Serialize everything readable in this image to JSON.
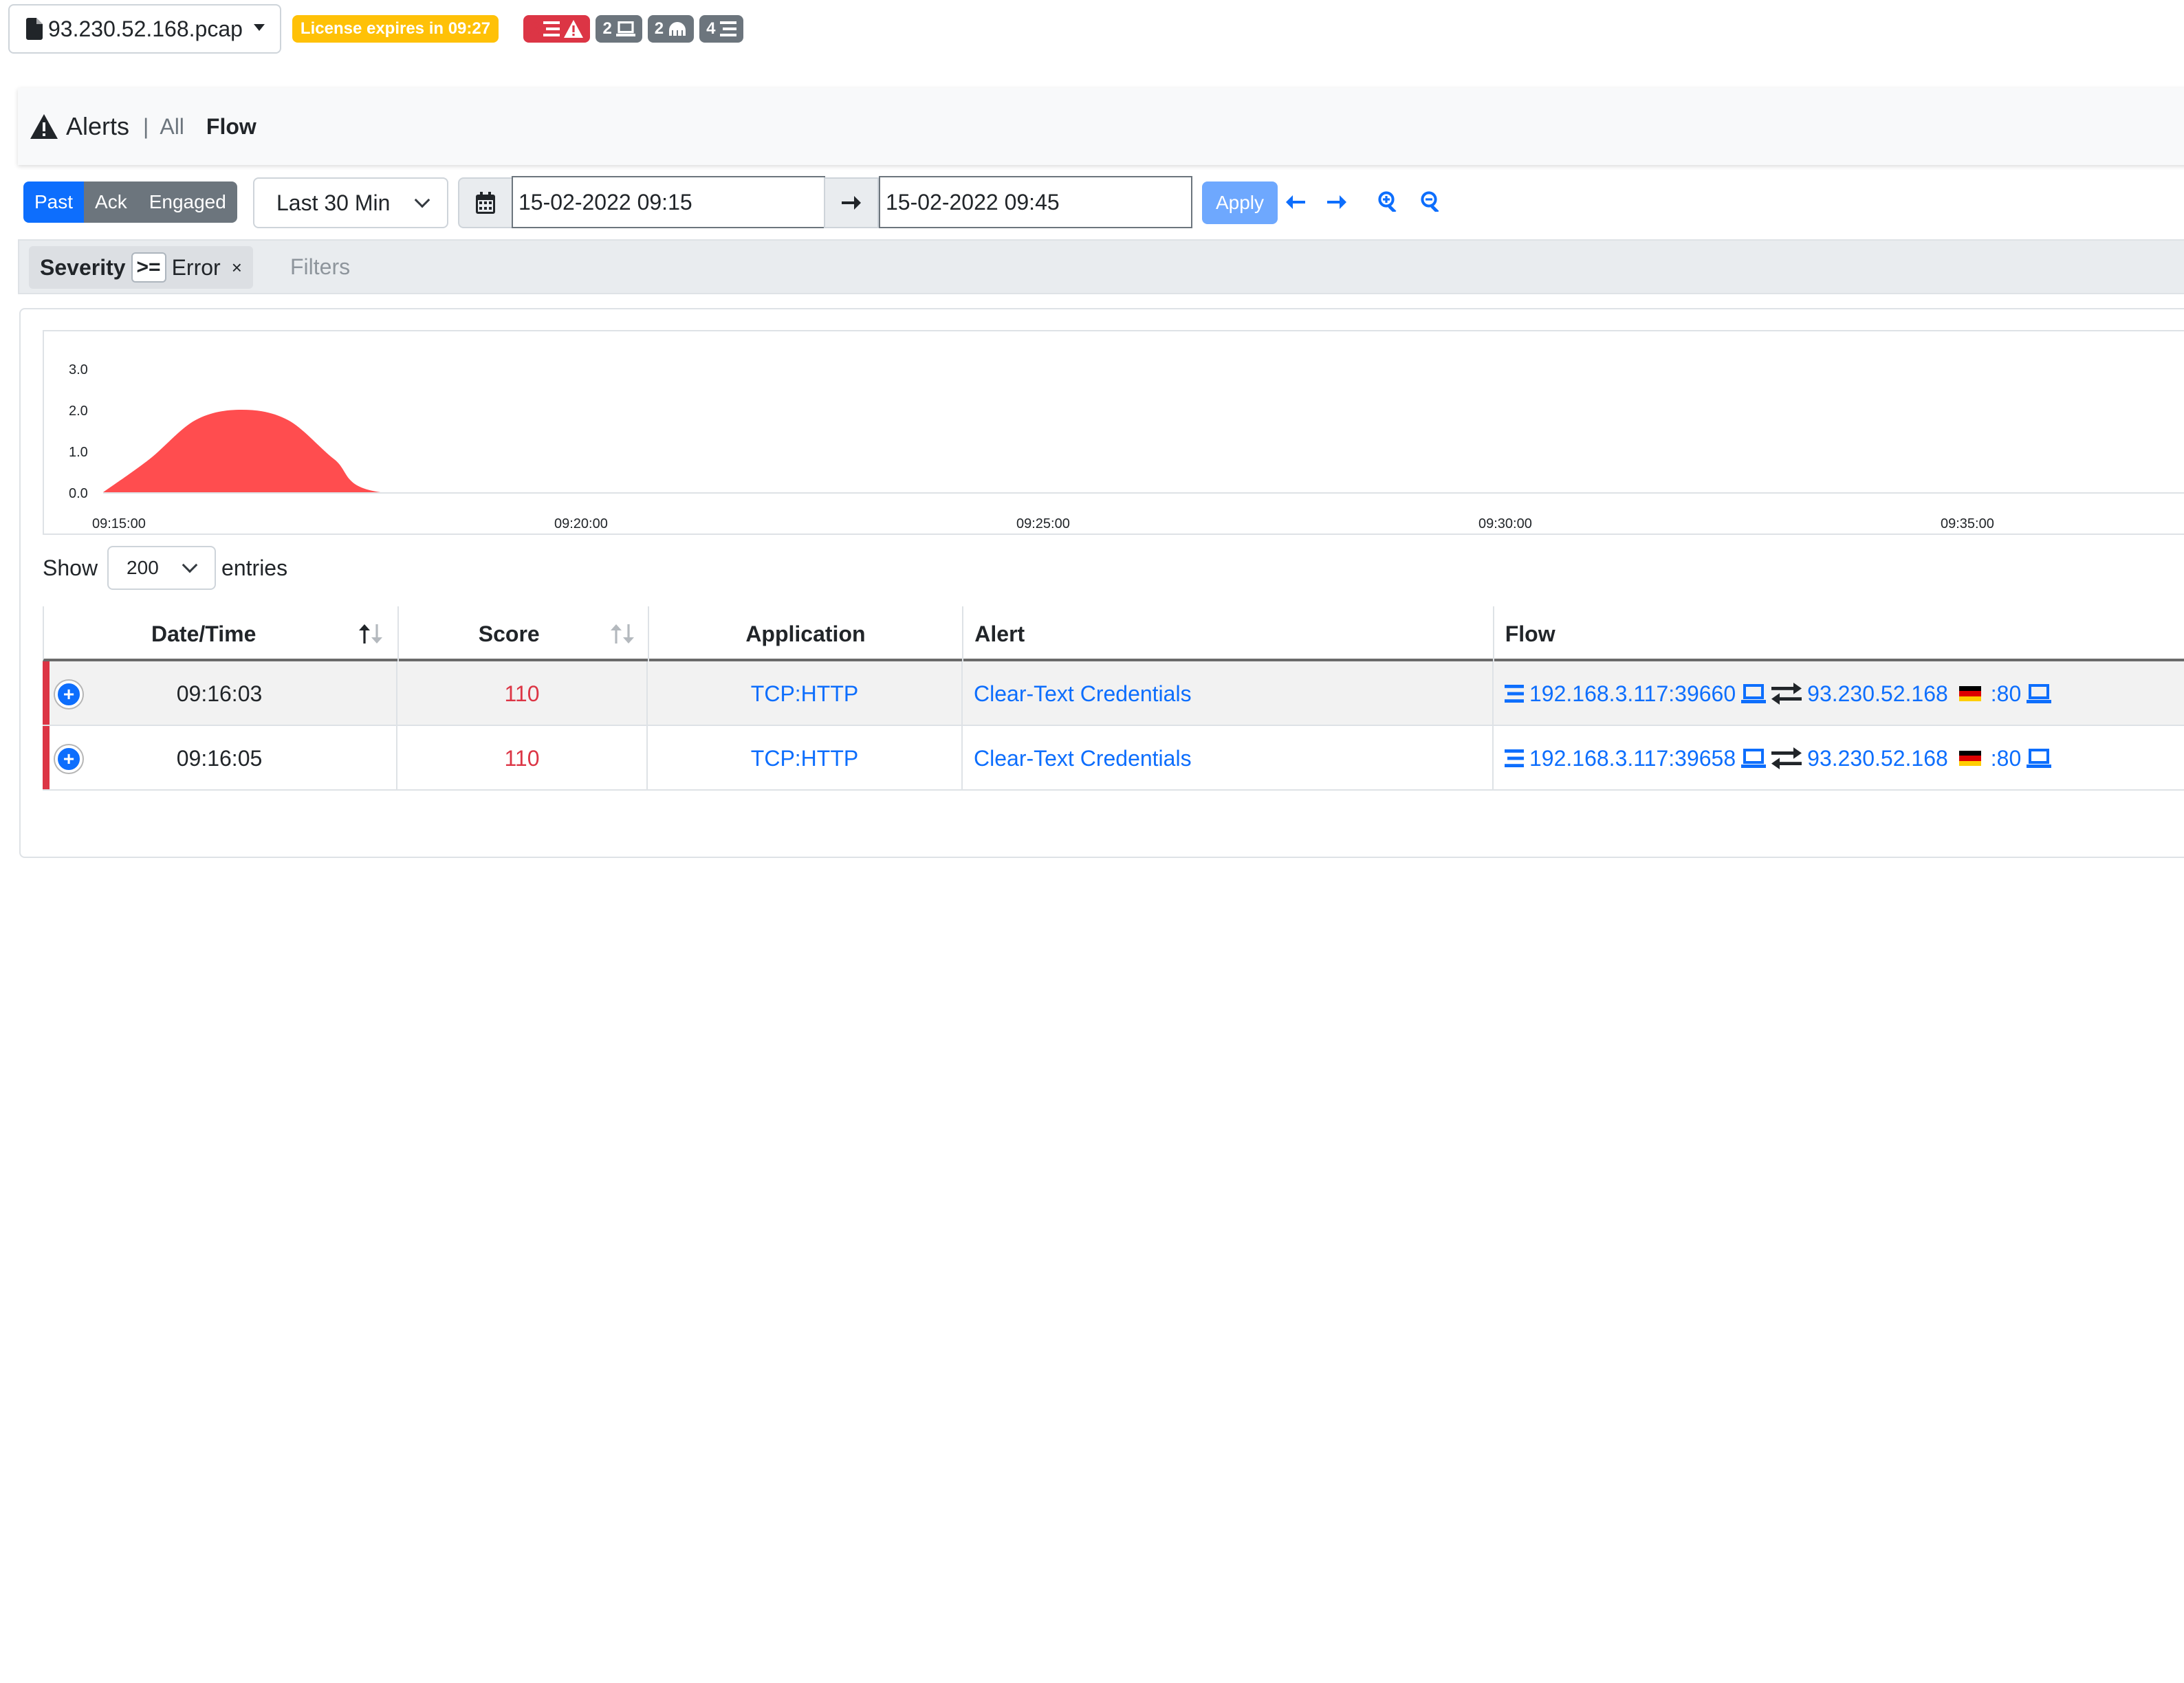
{
  "topbar": {
    "pcap_name": "93.230.52.168.pcap",
    "license_text": "License expires in 09:27",
    "badges": [
      {
        "count": "2",
        "icon": "flows-alert-icon",
        "color": "#dc3545"
      },
      {
        "count": "2",
        "icon": "laptop-icon",
        "color": "#6c757d"
      },
      {
        "count": "2",
        "icon": "network-icon",
        "color": "#6c757d"
      },
      {
        "count": "4",
        "icon": "flows-icon",
        "color": "#6c757d"
      }
    ]
  },
  "header": {
    "title": "Alerts",
    "separator": "|",
    "tab_all": "All",
    "tab_flow": "Flow"
  },
  "controls": {
    "status_buttons": [
      "Past",
      "Ack",
      "Engaged"
    ],
    "active_status": "Past",
    "range_select": "Last 30 Min",
    "date_from": "15-02-2022 09:15",
    "date_to": "15-02-2022 09:45",
    "apply_label": "Apply"
  },
  "filters": {
    "chip_field": "Severity",
    "chip_operator": ">=",
    "chip_value": "Error",
    "chip_remove": "×",
    "placeholder": "Filters"
  },
  "chart_data": {
    "type": "area",
    "title": "",
    "xlabel": "",
    "ylabel": "",
    "y_ticks": [
      "0.0",
      "1.0",
      "2.0",
      "3.0"
    ],
    "ylim": [
      0,
      3
    ],
    "x_ticks": [
      "09:15:00",
      "09:20:00",
      "09:25:00",
      "09:30:00",
      "09:35:00"
    ],
    "series": [
      {
        "color": "#ff4d4f",
        "x": [
          "09:15:00",
          "09:15:30",
          "09:16:00",
          "09:16:30",
          "09:17:00",
          "09:17:30",
          "09:18:00",
          "09:20:00",
          "09:25:00",
          "09:30:00",
          "09:35:00"
        ],
        "values": [
          0,
          0.8,
          1.75,
          2.0,
          1.75,
          0.8,
          0,
          0,
          0,
          0,
          0
        ]
      }
    ],
    "grid": false,
    "legend": "none"
  },
  "table": {
    "show_label": "Show",
    "entries_value": "200",
    "entries_label": "entries",
    "columns": [
      "Date/Time",
      "Score",
      "Application",
      "Alert",
      "Flow"
    ],
    "rows": [
      {
        "time": "09:16:03",
        "score": "110",
        "app": "TCP:HTTP",
        "alert": "Clear-Text Credentials",
        "src_ip": "192.168.3.117",
        "src_port": ":39660",
        "dst_ip": "93.230.52.168",
        "dst_port": ":80"
      },
      {
        "time": "09:16:05",
        "score": "110",
        "app": "TCP:HTTP",
        "alert": "Clear-Text Credentials",
        "src_ip": "192.168.3.117",
        "src_port": ":39658",
        "dst_ip": "93.230.52.168",
        "dst_port": ":80"
      }
    ]
  }
}
